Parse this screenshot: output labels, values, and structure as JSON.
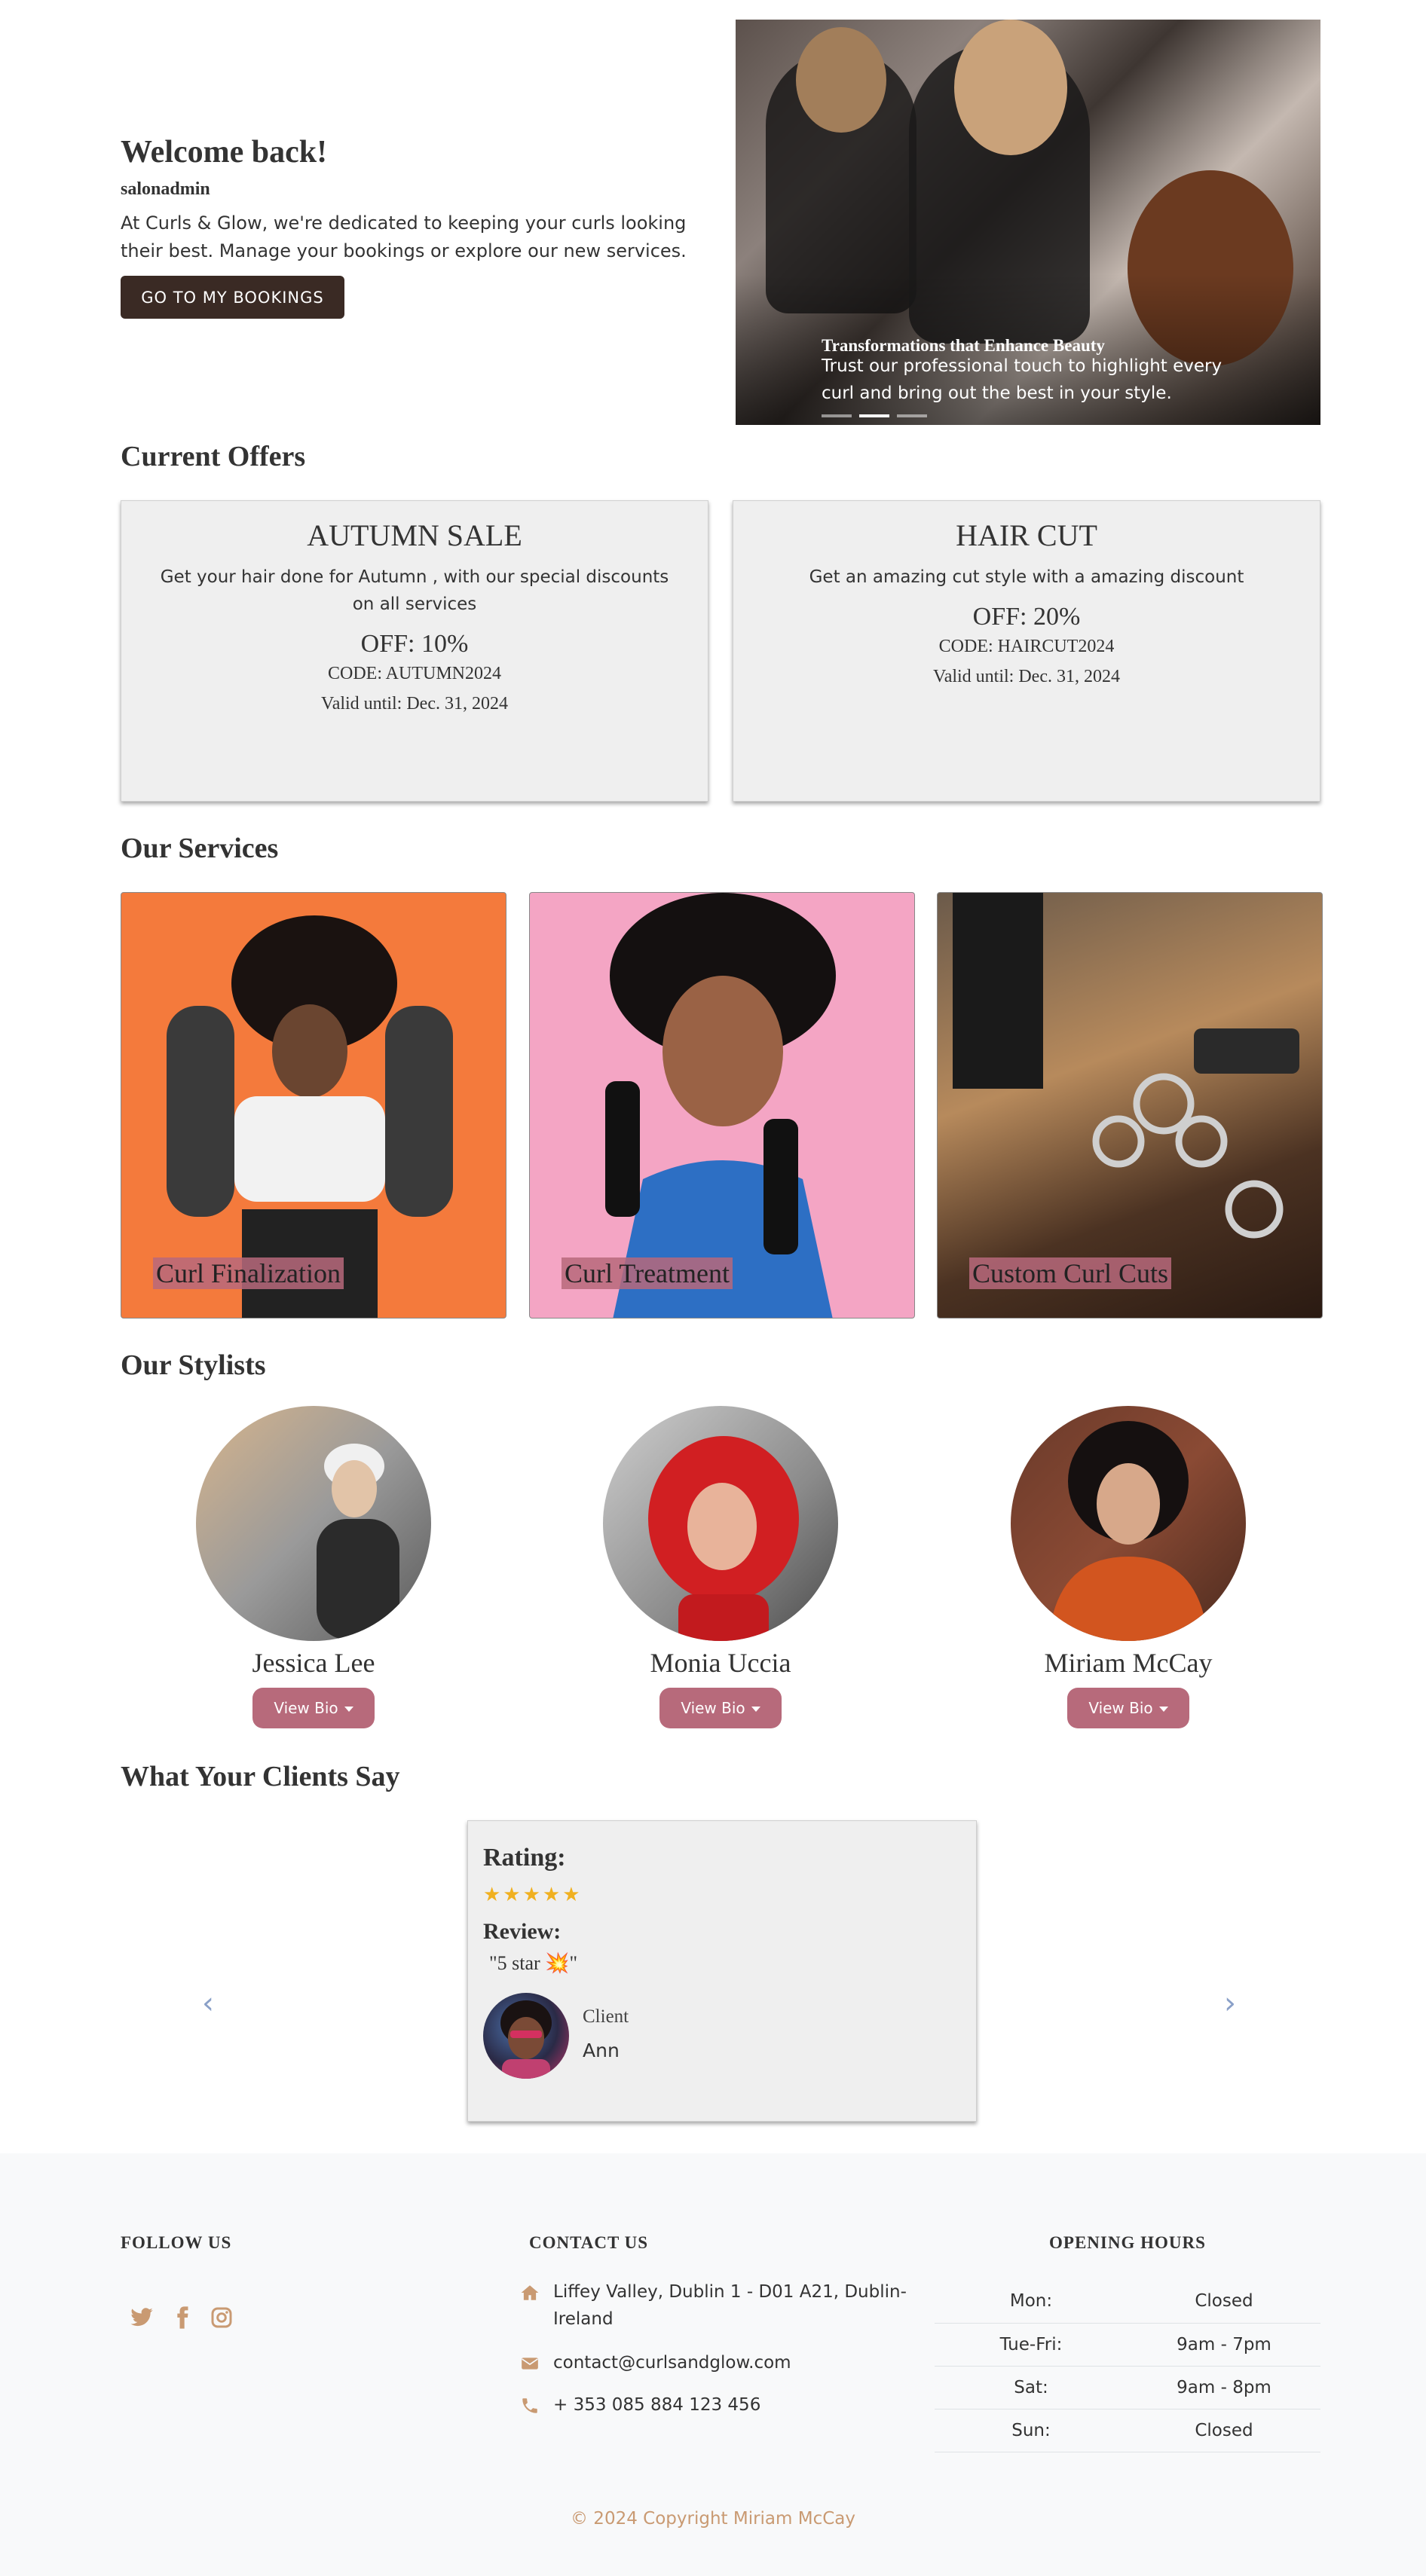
{
  "hero": {
    "welcome_title": "Welcome back!",
    "username": "salonadmin",
    "welcome_text": "At Curls & Glow, we're dedicated to keeping your curls looking their best. Manage your bookings or explore our new services.",
    "bookings_button": "GO TO MY BOOKINGS",
    "carousel": {
      "caption_title": "Transformations that Enhance Beauty",
      "caption_text": "Trust our professional touch to highlight every curl and bring out the best in your style.",
      "slide_count": 3,
      "active_slide": 2
    }
  },
  "offers": {
    "section_title": "Current Offers",
    "items": [
      {
        "title": "AUTUMN SALE",
        "description": "Get your hair done for Autumn , with our special discounts on all services",
        "off": "OFF: 10%",
        "code": "CODE: AUTUMN2024",
        "valid": "Valid until: Dec. 31, 2024"
      },
      {
        "title": "HAIR CUT",
        "description": "Get an amazing cut style with a amazing discount",
        "off": "OFF: 20%",
        "code": "CODE: HAIRCUT2024",
        "valid": "Valid until: Dec. 31, 2024"
      }
    ]
  },
  "services": {
    "section_title": "Our Services",
    "items": [
      {
        "label": "Curl Finalization"
      },
      {
        "label": "Curl Treatment"
      },
      {
        "label": "Custom Curl Cuts"
      }
    ]
  },
  "stylists": {
    "section_title": "Our Stylists",
    "bio_button": "View Bio",
    "items": [
      {
        "name": "Jessica Lee"
      },
      {
        "name": "Monia Uccia"
      },
      {
        "name": "Miriam McCay"
      }
    ]
  },
  "testimonials": {
    "section_title": "What Your Clients Say",
    "rating_label": "Rating:",
    "stars": "★★★★★",
    "star_count": 5,
    "review_label": "Review:",
    "review_text": "\"5 star 💥\"",
    "client_label": "Client",
    "client_name": "Ann",
    "prev_arrow": "‹",
    "next_arrow": "›"
  },
  "footer": {
    "follow_heading": "FOLLOW US",
    "social": [
      "twitter-icon",
      "facebook-icon",
      "instagram-icon"
    ],
    "contact_heading": "CONTACT US",
    "address": "Liffey Valley, Dublin 1 - D01 A21, Dublin-Ireland",
    "email": "contact@curlsandglow.com",
    "phone": "+ 353 085 884 123 456",
    "hours_heading": "OPENING HOURS",
    "hours": [
      {
        "day": "Mon:",
        "time": "Closed"
      },
      {
        "day": "Tue-Fri:",
        "time": "9am - 7pm"
      },
      {
        "day": "Sat:",
        "time": "9am - 8pm"
      },
      {
        "day": "Sun:",
        "time": "Closed"
      }
    ],
    "copyright": "© 2024 Copyright Miriam McCay"
  },
  "colors": {
    "primary_dark": "#3a2a24",
    "accent_pink": "#b76a7b",
    "accent_tan": "#c99a72",
    "card_bg": "#efefef",
    "footer_bg": "#f8f9fa",
    "star": "#f0b020"
  }
}
